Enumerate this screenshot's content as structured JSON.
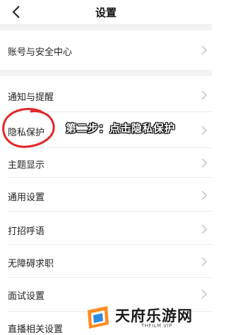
{
  "header": {
    "title": "设置",
    "back_icon": "chevron-left-icon"
  },
  "settings": {
    "items": [
      {
        "label": "账号与安全中心"
      },
      {
        "label": "通知与提醒"
      },
      {
        "label": "隐私保护"
      },
      {
        "label": "主题显示"
      },
      {
        "label": "通用设置"
      },
      {
        "label": "打招呼语"
      },
      {
        "label": "无障碍求职"
      },
      {
        "label": "面试设置"
      },
      {
        "label": "直播相关设置"
      }
    ]
  },
  "annotation": {
    "text": "第二步：点击隐私保护",
    "circle_color": "#e0262a"
  },
  "watermark": {
    "name": "天府乐游网",
    "sub": "THFILM VIP",
    "accent": "#ff8a1f"
  },
  "colors": {
    "background": "#ffffff",
    "section_gap": "#f3f3f3",
    "chevron": "#c4c4c4"
  }
}
